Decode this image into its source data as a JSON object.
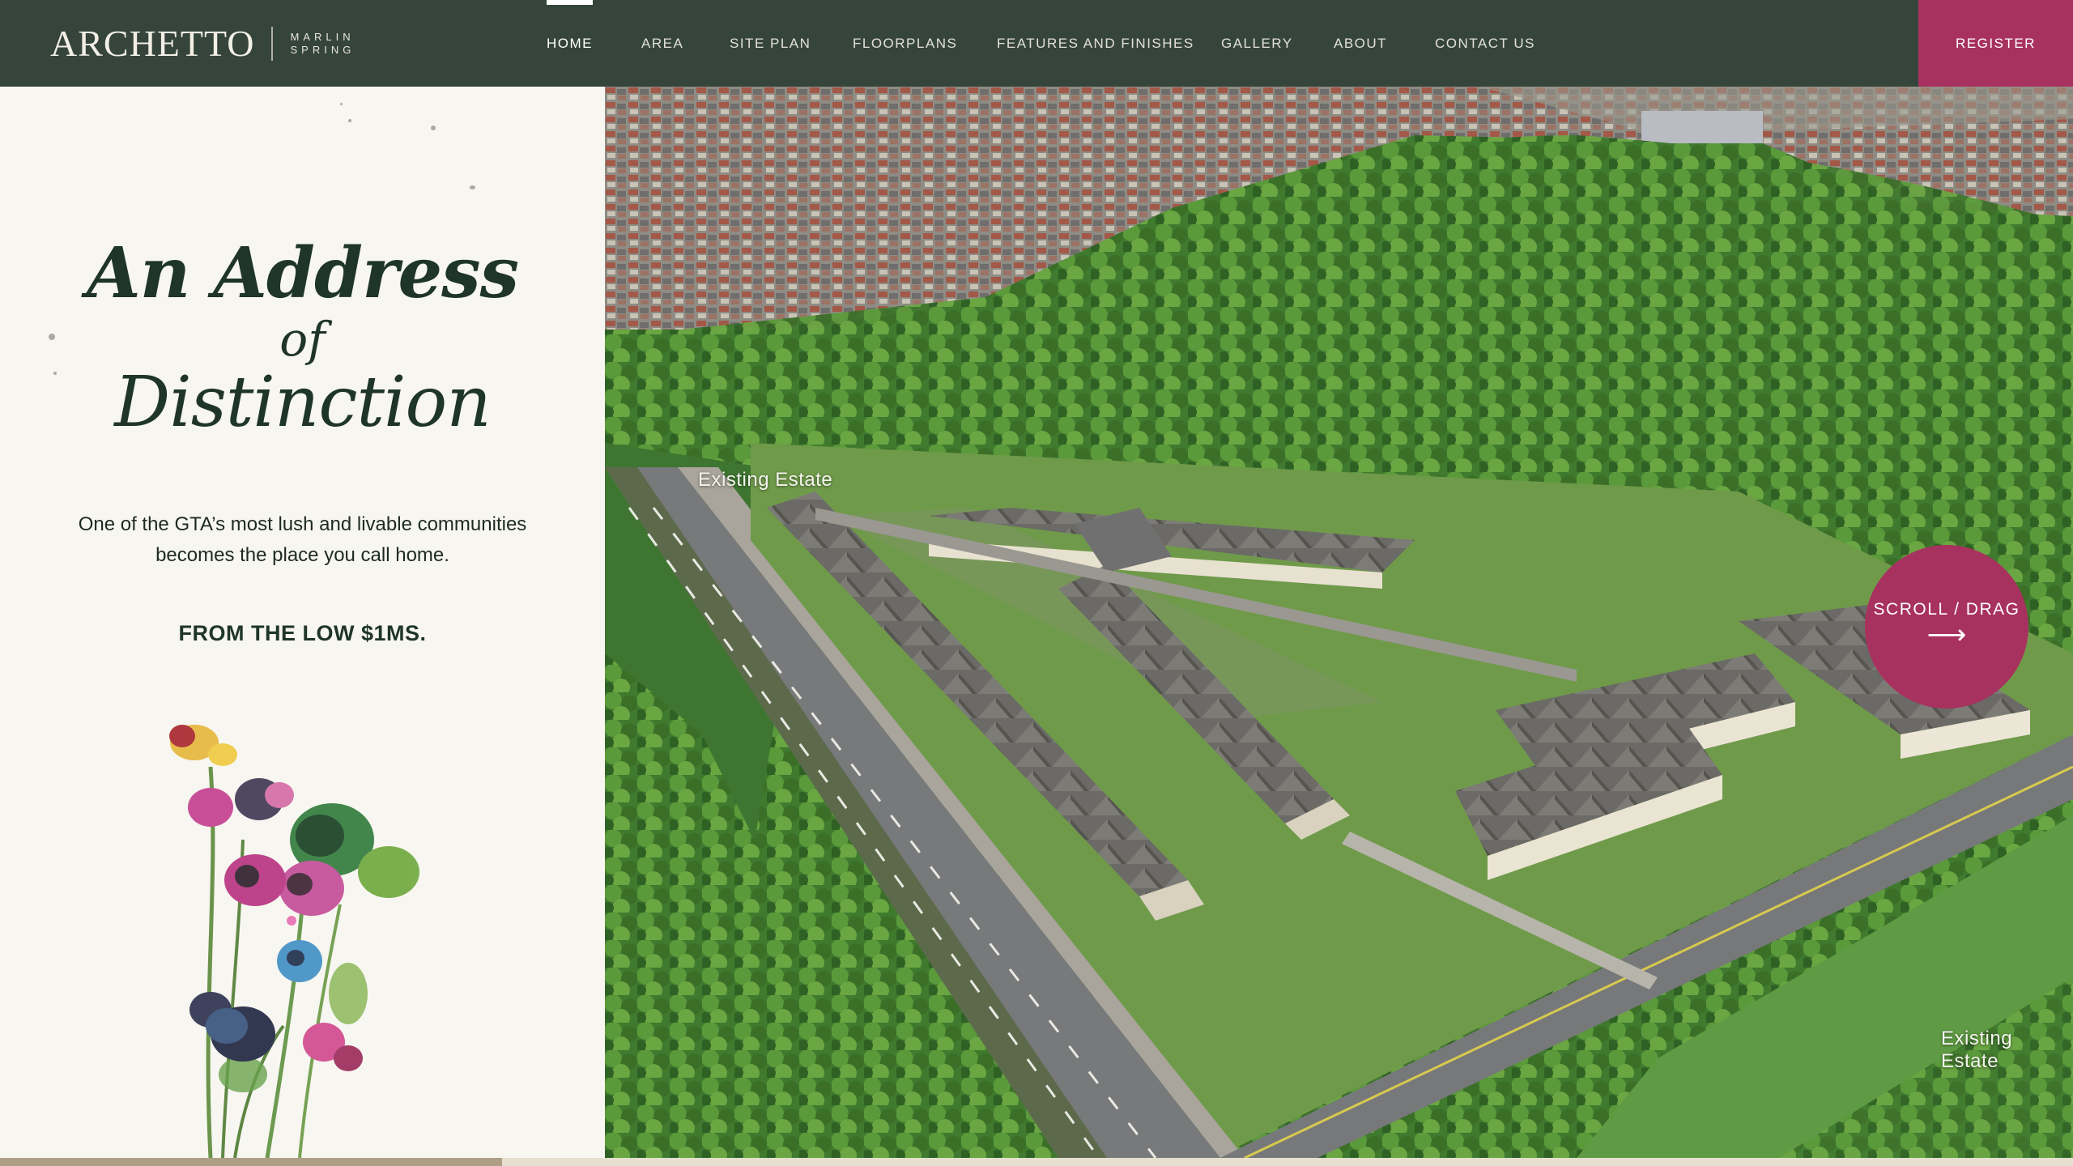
{
  "brand": {
    "logo": "ARCHETTO",
    "sub_line1": "MARLIN",
    "sub_line2": "SPRING"
  },
  "nav": {
    "items": [
      {
        "label": "HOME",
        "active": true
      },
      {
        "label": "AREA",
        "active": false
      },
      {
        "label": "SITE PLAN",
        "active": false
      },
      {
        "label": "FLOORPLANS",
        "active": false
      },
      {
        "label": "FEATURES AND FINISHES",
        "active": false
      },
      {
        "label": "GALLERY",
        "active": false
      },
      {
        "label": "ABOUT",
        "active": false
      },
      {
        "label": "CONTACT US",
        "active": false
      }
    ],
    "register_label": "REGISTER"
  },
  "hero": {
    "headline_line1": "An Address",
    "headline_line2": "of",
    "headline_line3": "Distinction",
    "intro": "One of the GTA’s most lush and livable communities becomes the place you call home.",
    "price": "FROM THE LOW $1MS."
  },
  "aerial": {
    "label_left": "Existing Estate",
    "label_right": "Existing Estate"
  },
  "scroll": {
    "label": "SCROLL / DRAG",
    "arrow": "⟶"
  },
  "progress": {
    "fraction": 0.242
  },
  "colors": {
    "header_bg": "#36453c",
    "accent": "#a8325f",
    "panel_bg": "#f7f6f0",
    "heading": "#1f3529"
  },
  "icons": {
    "scroll_arrow": "arrow-right-icon"
  }
}
